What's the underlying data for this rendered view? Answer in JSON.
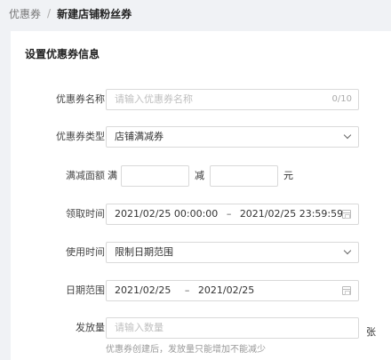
{
  "breadcrumb": {
    "parent": "优惠券",
    "separator": "/",
    "current": "新建店铺粉丝券"
  },
  "form": {
    "section_title": "设置优惠券信息",
    "name": {
      "label": "优惠券名称",
      "placeholder": "请输入优惠券名称",
      "counter": "0/10"
    },
    "type": {
      "label": "优惠券类型",
      "value": "店铺满减券"
    },
    "threshold": {
      "label": "满减面额",
      "full_text": "满",
      "minus_text": "减",
      "unit_text": "元"
    },
    "claim_time": {
      "label": "领取时间",
      "start": "2021/02/25 00:00:00",
      "separator": "–",
      "end": "2021/02/25 23:59:59"
    },
    "use_time": {
      "label": "使用时间",
      "value": "限制日期范围"
    },
    "date_range": {
      "label": "日期范围",
      "start": "2021/02/25",
      "separator": "–",
      "end": "2021/02/25"
    },
    "quantity": {
      "label": "发放量",
      "placeholder": "请输入数量",
      "unit_text": "张",
      "hint": "优惠券创建后，发放量只能增加不能减少"
    }
  },
  "icons": {
    "dropdown": "chevron-down-icon",
    "calendar": "calendar-icon"
  }
}
